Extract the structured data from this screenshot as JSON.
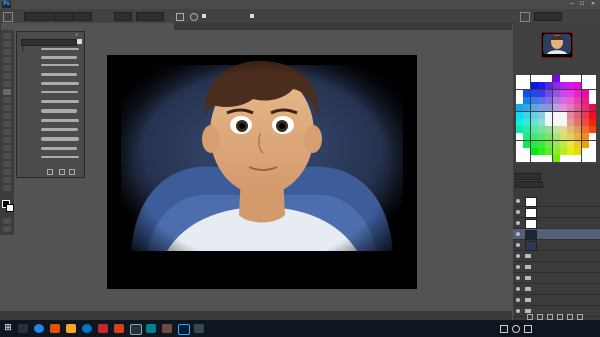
{
  "app": {
    "logo": "Ps"
  },
  "menu": [],
  "window_controls": {
    "minimize": "—",
    "maximize": "☐",
    "close": "✕"
  },
  "options": {
    "mode": "",
    "opacity": "",
    "smoothing": "",
    "delete_cropped": "",
    "content_aware": ""
  },
  "document": {
    "tab_title": "",
    "zoom": "",
    "doc_info": ""
  },
  "brush_panel": {
    "title": ""
  },
  "panels": {
    "navigator": "",
    "swatches": "",
    "layers": ""
  },
  "layers_panel": {
    "blend_mode": "",
    "opacity": "",
    "fill": ""
  },
  "layers": [
    {
      "name": ""
    },
    {
      "name": ""
    },
    {
      "name": ""
    },
    {
      "name": ""
    },
    {
      "name": ""
    },
    {
      "name": ""
    },
    {
      "name": ""
    },
    {
      "name": ""
    },
    {
      "name": ""
    },
    {
      "name": ""
    },
    {
      "name": ""
    }
  ],
  "taskbar": {
    "time": "",
    "date": "",
    "lang": ""
  },
  "colors": {
    "ps_blue": "#31a8ff",
    "panel_bg": "#404040",
    "canvas_bg": "#535353",
    "taskbar_bg": "#101620"
  }
}
